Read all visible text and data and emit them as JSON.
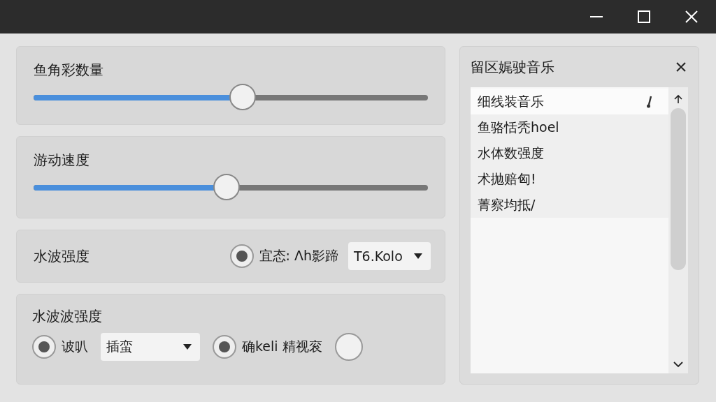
{
  "settings": [
    {
      "kind": "slider",
      "label": "鱼角彩数量",
      "level": 0.53
    },
    {
      "kind": "slider",
      "label": "游动速度",
      "level": 0.49
    },
    {
      "kind": "options",
      "label": "水波强度",
      "controls": [
        {
          "kind": "radio",
          "label": "宜态: Λh影蹄",
          "selected": true
        },
        {
          "kind": "dropdown",
          "value": "T6.Kolo"
        }
      ]
    },
    {
      "kind": "options",
      "label": "水波波强度",
      "controls": [
        {
          "kind": "radio",
          "label": "诐叭",
          "selected": true
        },
        {
          "kind": "dropdown",
          "value": "插蛮"
        },
        {
          "kind": "radio",
          "label": "确keli 精视衮",
          "selected": true
        },
        {
          "kind": "swatch"
        }
      ]
    }
  ],
  "music_panel": {
    "title": "留区娓驶音乐",
    "items": [
      {
        "label": "细线装音乐",
        "selected": true
      },
      {
        "label": "鱼骆恬秃hoel",
        "selected": false
      },
      {
        "label": "水体数强度",
        "selected": false
      },
      {
        "label": "术抛赔匈!",
        "selected": false
      },
      {
        "label": "菁察均抵/",
        "selected": false
      }
    ]
  }
}
